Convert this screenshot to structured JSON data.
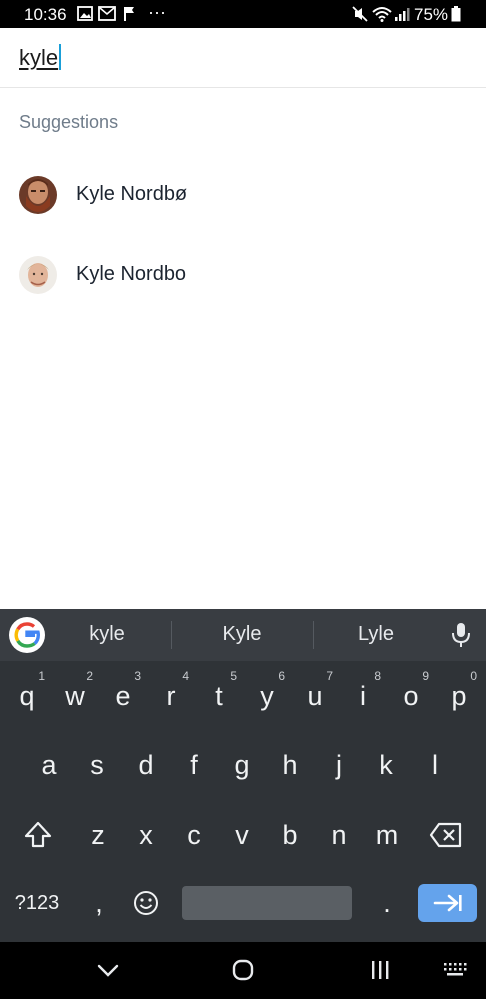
{
  "status_bar": {
    "time": "10:36",
    "battery": "75%",
    "overflow": "···"
  },
  "search": {
    "query": "kyle"
  },
  "suggestions": {
    "title": "Suggestions",
    "items": [
      {
        "name": "Kyle Nordbø",
        "avatar": "avatar-red-beard"
      },
      {
        "name": "Kyle Nordbo",
        "avatar": "avatar-blond"
      }
    ]
  },
  "keyboard": {
    "word_suggestions": [
      "kyle",
      "Kyle",
      "Lyle"
    ],
    "row1": [
      {
        "k": "q",
        "n": "1"
      },
      {
        "k": "w",
        "n": "2"
      },
      {
        "k": "e",
        "n": "3"
      },
      {
        "k": "r",
        "n": "4"
      },
      {
        "k": "t",
        "n": "5"
      },
      {
        "k": "y",
        "n": "6"
      },
      {
        "k": "u",
        "n": "7"
      },
      {
        "k": "i",
        "n": "8"
      },
      {
        "k": "o",
        "n": "9"
      },
      {
        "k": "p",
        "n": "0"
      }
    ],
    "row2": [
      "a",
      "s",
      "d",
      "f",
      "g",
      "h",
      "j",
      "k",
      "l"
    ],
    "row3": [
      "z",
      "x",
      "c",
      "v",
      "b",
      "n",
      "m"
    ],
    "symbols_label": "?123",
    "comma": ",",
    "period": ".",
    "accent_color": "#64a3ec"
  },
  "icons": {
    "status": [
      "gallery-icon",
      "email-icon",
      "flag-icon",
      "mute-icon",
      "wifi-icon",
      "signal-icon",
      "battery-icon"
    ],
    "keyboard": [
      "google-icon",
      "mic-icon",
      "shift-icon",
      "backspace-icon",
      "emoji-icon",
      "enter-icon"
    ],
    "nav": [
      "back-icon",
      "home-icon",
      "recents-icon",
      "keyboard-hide-icon"
    ]
  }
}
